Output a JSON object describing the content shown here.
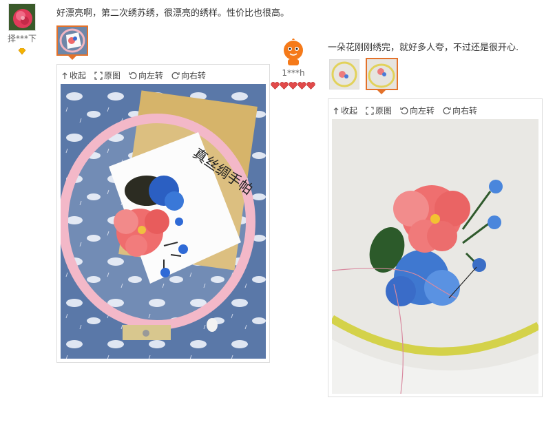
{
  "reviews": [
    {
      "user": {
        "name": "择***下",
        "badge": "gold-diamond-icon"
      },
      "text": "好漂亮啊，第二次绣苏绣，很漂亮的绣样。性价比也很高。",
      "thumbnails": [
        {
          "active": true,
          "desc": "embroidery-hoop-thumb"
        }
      ],
      "viewer": {
        "tools": [
          "收起",
          "原图",
          "向左转",
          "向右转"
        ],
        "photo_label": "真丝绸手帕"
      }
    },
    {
      "user": {
        "name": "1***h",
        "hearts": 5
      },
      "text": "一朵花刚刚绣完，就好多人夸，不过还是很开心.",
      "thumbnails": [
        {
          "active": false,
          "desc": "embroidery-thumb-1"
        },
        {
          "active": true,
          "desc": "embroidery-thumb-2"
        }
      ],
      "viewer": {
        "tools": [
          "收起",
          "原图",
          "向左转",
          "向右转"
        ]
      }
    }
  ],
  "colors": {
    "accent": "#e4722a",
    "heart": "#e24a4a",
    "border": "#dddddd"
  }
}
